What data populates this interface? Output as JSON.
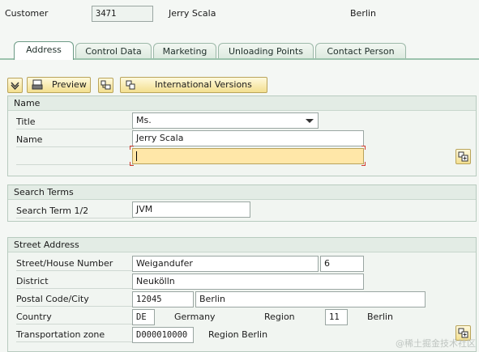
{
  "header": {
    "customer_label": "Customer",
    "customer_number": "3471",
    "customer_name": "Jerry Scala",
    "city": "Berlin"
  },
  "tabs": [
    {
      "label": "Address",
      "active": true
    },
    {
      "label": "Control Data",
      "active": false
    },
    {
      "label": "Marketing",
      "active": false
    },
    {
      "label": "Unloading Points",
      "active": false
    },
    {
      "label": "Contact Person",
      "active": false
    }
  ],
  "toolbar": {
    "preview_label": "Preview",
    "international_versions_label": "International Versions"
  },
  "name_section": {
    "title": "Name",
    "title_label": "Title",
    "title_value": "Ms.",
    "name_label": "Name",
    "name_value": "Jerry Scala",
    "name2_value": ""
  },
  "search_terms": {
    "title": "Search Terms",
    "search_term_label": "Search Term 1/2",
    "search_term_value": "JVM"
  },
  "street_address": {
    "title": "Street Address",
    "street_label": "Street/House Number",
    "street_value": "Weigandufer",
    "house_number": "6",
    "district_label": "District",
    "district_value": "Neukölln",
    "postal_city_label": "Postal Code/City",
    "postal_code": "12045",
    "city_value": "Berlin",
    "country_label": "Country",
    "country_code": "DE",
    "country_name": "Germany",
    "region_label": "Region",
    "region_code": "11",
    "region_name": "Berlin",
    "transport_zone_label": "Transportation zone",
    "transport_zone_code": "D000010000",
    "transport_zone_name": "Region Berlin"
  },
  "watermark": "@稀土掘金技术社区",
  "colors": {
    "tab_border": "#9cb8a8",
    "button_fill": "#f3df8f",
    "focus_field": "#ffe7a8"
  }
}
